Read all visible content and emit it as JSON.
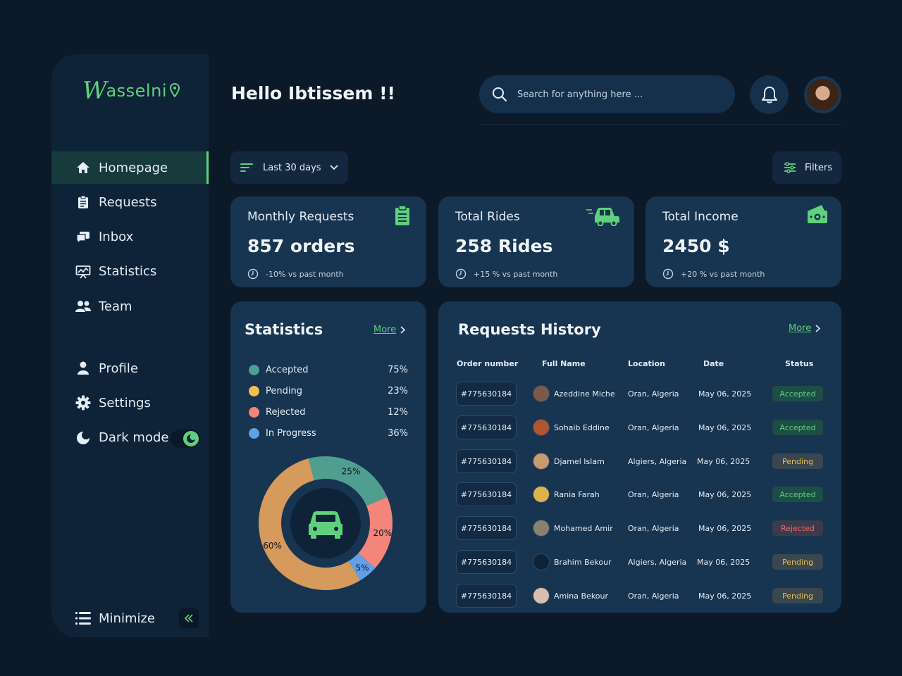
{
  "brand": {
    "name": "asselni",
    "initial": "W",
    "color": "#5fd07c"
  },
  "sidebar": {
    "items": [
      {
        "label": "Homepage",
        "icon": "home-icon",
        "active": true
      },
      {
        "label": "Requests",
        "icon": "clipboard-icon",
        "active": false
      },
      {
        "label": "Inbox",
        "icon": "chat-icon",
        "active": false
      },
      {
        "label": "Statistics",
        "icon": "presentation-chart-icon",
        "active": false
      },
      {
        "label": "Team",
        "icon": "team-icon",
        "active": false
      }
    ],
    "secondary": [
      {
        "label": "Profile",
        "icon": "user-icon"
      },
      {
        "label": "Settings",
        "icon": "gear-icon"
      },
      {
        "label": "Dark mode",
        "icon": "moon-icon",
        "toggle_on": true
      }
    ],
    "minimize_label": "Minimize"
  },
  "header": {
    "greeting": "Hello Ibtissem !!",
    "search_placeholder": "Search for anything here ..."
  },
  "filters": {
    "range_label": "Last 30 days",
    "filters_label": "Filters"
  },
  "stats_cards": [
    {
      "label": "Monthly Requests",
      "value": "857 orders",
      "change": "-10% vs past month",
      "icon": "clipboard-icon"
    },
    {
      "label": "Total Rides",
      "value": "258 Rides",
      "change": "+15 % vs past month",
      "icon": "car-icon"
    },
    {
      "label": "Total Income",
      "value": "2450 $",
      "change": "+20 % vs past month",
      "icon": "money-icon"
    }
  ],
  "statistics": {
    "title": "Statistics",
    "more_label": "More",
    "legend": [
      {
        "name": "Accepted",
        "value": "75%",
        "color": "#4f9e8f"
      },
      {
        "name": "Pending",
        "value": "23%",
        "color": "#f4bd52"
      },
      {
        "name": "Rejected",
        "value": "12%",
        "color": "#f3857a"
      },
      {
        "name": "In Progress",
        "value": "36%",
        "color": "#5fa0e8"
      }
    ]
  },
  "chart_data": {
    "type": "pie",
    "categories": [
      "Accepted",
      "Rejected",
      "In Progress",
      "Pending"
    ],
    "values": [
      25,
      20,
      5,
      60
    ],
    "labels": [
      "25%",
      "20%",
      "5%",
      "60%"
    ],
    "colors": [
      "#4f9e8f",
      "#f3857a",
      "#5fa0e8",
      "#d59a5c"
    ]
  },
  "history": {
    "title": "Requests History",
    "more_label": "More",
    "columns": [
      "Order number",
      "Full Name",
      "Location",
      "Date",
      "Status"
    ],
    "rows": [
      {
        "order": "#775630184",
        "name": "Azeddine Miche",
        "location": "Oran, Algeria",
        "date": "May 06, 2025",
        "status": "Accepted",
        "avatar_color": "#7a5a48"
      },
      {
        "order": "#775630184",
        "name": "Sohaib Eddine",
        "location": "Oran, Algeria",
        "date": "May 06, 2025",
        "status": "Accepted",
        "avatar_color": "#b0552f"
      },
      {
        "order": "#775630184",
        "name": "Djamel Islam",
        "location": "Algiers, Algeria",
        "date": "May 06, 2025",
        "status": "Pending",
        "avatar_color": "#c99a6d"
      },
      {
        "order": "#775630184",
        "name": "Rania Farah",
        "location": "Oran, Algeria",
        "date": "May 06, 2025",
        "status": "Accepted",
        "avatar_color": "#e0b24a"
      },
      {
        "order": "#775630184",
        "name": "Mohamed Amir",
        "location": "Oran, Algeria",
        "date": "May 06, 2025",
        "status": "Rejected",
        "avatar_color": "#8a8070"
      },
      {
        "order": "#775630184",
        "name": "Brahim Bekour",
        "location": "Algiers, Algeria",
        "date": "May 06, 2025",
        "status": "Pending",
        "avatar_color": "#0f2338"
      },
      {
        "order": "#775630184",
        "name": "Amina Bekour",
        "location": "Oran, Algeria",
        "date": "May 06, 2025",
        "status": "Pending",
        "avatar_color": "#d9bfae"
      }
    ]
  }
}
